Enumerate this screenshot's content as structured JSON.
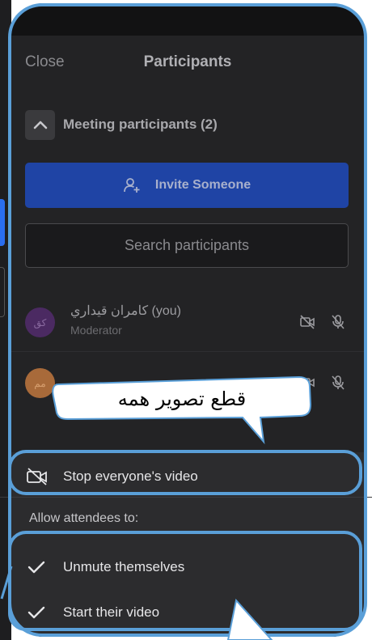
{
  "header": {
    "close_label": "Close",
    "title": "Participants"
  },
  "section": {
    "label": "Meeting participants (2)"
  },
  "invite": {
    "label": "Invite Someone"
  },
  "search": {
    "placeholder": "Search participants"
  },
  "participants": [
    {
      "avatar": "كق",
      "name": "كامران قيداري (you)",
      "role": "Moderator"
    },
    {
      "avatar": "مم",
      "name": "",
      "role": ""
    }
  ],
  "menu": {
    "stop_video_label": "Stop everyone's video",
    "allow_label": "Allow attendees to:",
    "unmute_label": "Unmute themselves",
    "start_video_label": "Start their video"
  },
  "annotation": {
    "callout_text": "قطع تصویر همه"
  },
  "colors": {
    "panel_bg": "#232325",
    "invite_blue": "#1f44a5",
    "highlight_blue": "#5a9fd8"
  }
}
